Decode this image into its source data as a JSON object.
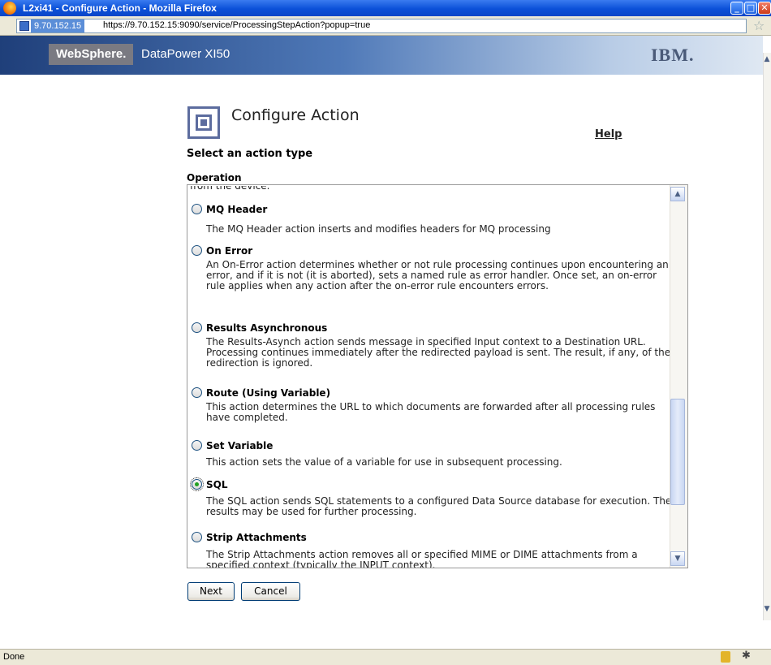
{
  "window": {
    "title": "L2xi41 - Configure Action - Mozilla Firefox",
    "minimize_glyph": "_",
    "maximize_glyph": "□",
    "close_glyph": "✕"
  },
  "addressbar": {
    "site_identity": "9.70.152.15",
    "url": "https://9.70.152.15:9090/service/ProcessingStepAction?popup=true"
  },
  "banner": {
    "brand": "WebSphere.",
    "product": "DataPower XI50",
    "vendor": "IBM."
  },
  "page": {
    "title": "Configure Action",
    "help_label": "Help",
    "section_heading": "Select an action type",
    "operation_label": "Operation",
    "cut_text": "from the device."
  },
  "operations": [
    {
      "name": "MQ Header",
      "description": "The MQ Header action inserts and modifies headers for MQ processing",
      "selected": false
    },
    {
      "name": "On Error",
      "description": "An On-Error action determines whether or not rule processing continues upon encountering an error, and if it is not (it is aborted), sets a named rule as error handler. Once set, an on-error rule applies when any action after the on-error rule encounters errors.",
      "selected": false
    },
    {
      "name": "Results Asynchronous",
      "description": "The Results-Asynch action sends message in specified Input context to a Destination URL. Processing continues immediately after the redirected payload is sent. The result, if any, of the redirection is ignored.",
      "selected": false
    },
    {
      "name": "Route (Using Variable)",
      "description": "This action determines the URL to which documents are forwarded after all processing rules have completed.",
      "selected": false
    },
    {
      "name": "Set Variable",
      "description": "This action sets the value of a variable for use in subsequent processing.",
      "selected": false
    },
    {
      "name": "SQL",
      "description": "The SQL action sends SQL statements to a configured Data Source database for execution. The results may be used for further processing.",
      "selected": true
    },
    {
      "name": "Strip Attachments",
      "description": "The Strip Attachments action removes all or specified MIME or DIME attachments from a specified context (typically the INPUT context).",
      "selected": false
    }
  ],
  "buttons": {
    "next_label": "Next",
    "cancel_label": "Cancel"
  },
  "statusbar": {
    "status_text": "Done"
  },
  "colors": {
    "titlebar": "#0b50d8",
    "banner_brand_bg": "#7a7a82",
    "icon_accent": "#5c6c9e",
    "selected_radio": "#21a121"
  }
}
